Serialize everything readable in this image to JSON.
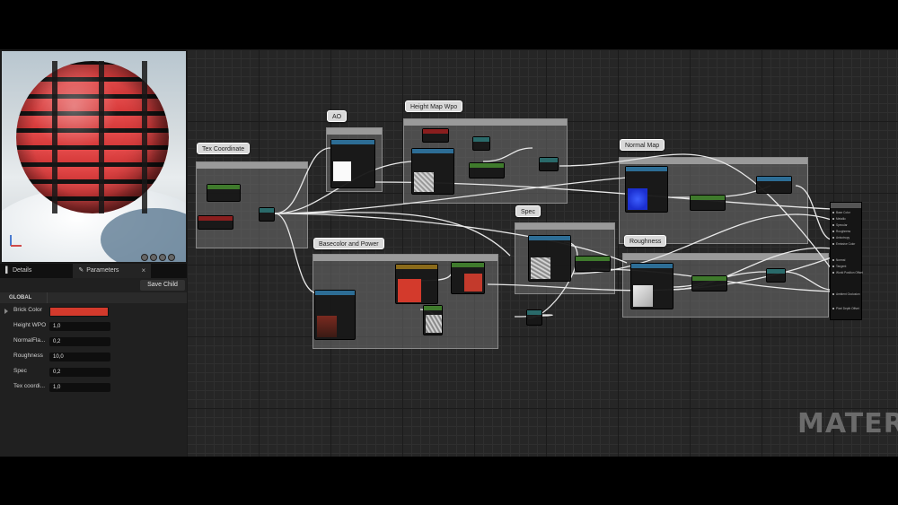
{
  "sidebar": {
    "tabs": [
      {
        "label": "Details"
      },
      {
        "label": "Parameters"
      }
    ],
    "save_child_label": "Save Child",
    "group_label": "GLOBAL",
    "params": [
      {
        "label": "Brick Color",
        "value": "",
        "color": "#d33a2c"
      },
      {
        "label": "Height WPO",
        "value": "1,0"
      },
      {
        "label": "NormalFla...",
        "value": "0,2"
      },
      {
        "label": "Roughness",
        "value": "10,0"
      },
      {
        "label": "Spec",
        "value": "0,2"
      },
      {
        "label": "Tex coordi...",
        "value": "1,0"
      }
    ]
  },
  "graph": {
    "comments": {
      "tex_coord": "Tex Coordinate",
      "ao": "AO",
      "height_map": "Height Map Wpo",
      "normal_map": "Normal Map",
      "spec": "Spec",
      "roughness": "Roughness",
      "basecolor": "Basecolor and Power"
    }
  },
  "watermark": "MATERIA"
}
